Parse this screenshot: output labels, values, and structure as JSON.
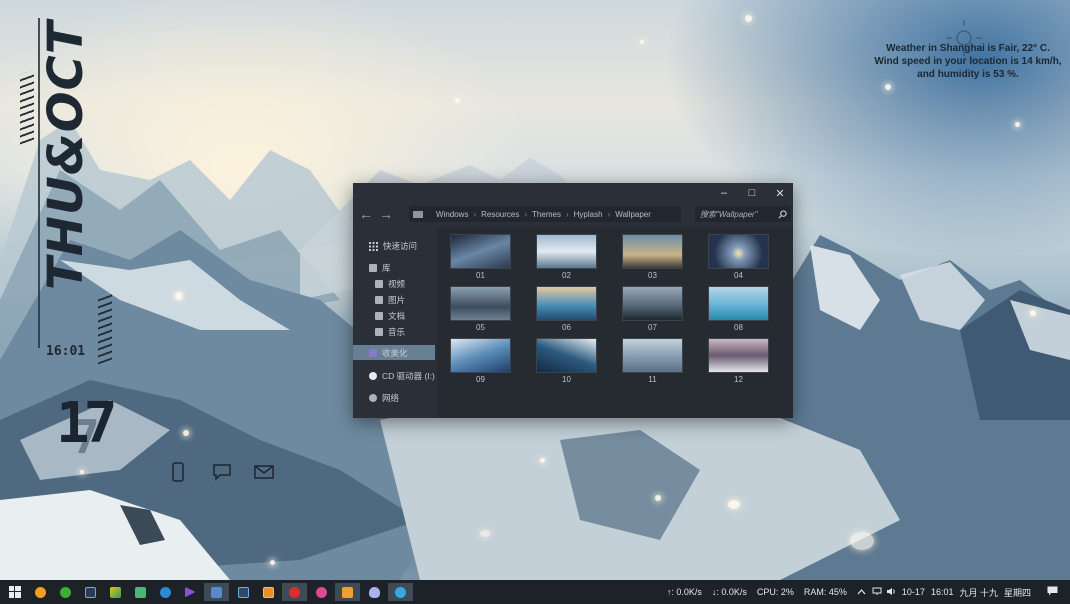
{
  "clock_widget": {
    "day": "THU&OCT",
    "time": "16:01",
    "date": "17",
    "date_shadow": "7"
  },
  "widget_icons": [
    "phone-icon",
    "chat-bubble-icon",
    "mail-icon"
  ],
  "weather": {
    "line1": "Weather in Shanghai is Fair, 22° C.",
    "line2": "Wind speed in your location is 14 km/h,",
    "line3": "and humidity is 53 %."
  },
  "explorer": {
    "controls": {
      "minimize": "–",
      "maximize": "□",
      "close": "✕"
    },
    "nav": {
      "back": "←",
      "forward": "→"
    },
    "breadcrumbs": [
      "Windows",
      "Resources",
      "Themes",
      "Hyplash",
      "Wallpaper"
    ],
    "breadcrumb_sep": "›",
    "search_placeholder": "搜索\"Wallpaper\"",
    "sidebar": {
      "quick_access": "快速访问",
      "library": "库",
      "videos": "视频",
      "pictures": "图片",
      "documents": "文档",
      "music": "音乐",
      "personalize": "收美化",
      "cd_drive": "CD 驱动器 (I:)",
      "network": "网络"
    },
    "thumbnails": [
      "01",
      "02",
      "03",
      "04",
      "05",
      "06",
      "07",
      "08",
      "09",
      "10",
      "11",
      "12"
    ]
  },
  "taskbar": {
    "upload": "↑: 0.0K/s",
    "download": "↓: 0.0K/s",
    "cpu": "CPU: 2%",
    "ram": "RAM: 45%",
    "date": "10-17",
    "time": "16:01",
    "lunar": "九月 十九",
    "weekday": "星期四",
    "apps": [
      "start-icon",
      "app-icon",
      "wechat-icon",
      "photoshop-icon",
      "app-green-icon",
      "gallery-icon",
      "browser-icon",
      "player-icon",
      "explorer-icon",
      "terminal-icon",
      "app-orange-icon",
      "record-icon",
      "app-pink-icon",
      "folder-icon",
      "qq-icon",
      "app-blue-icon"
    ]
  }
}
